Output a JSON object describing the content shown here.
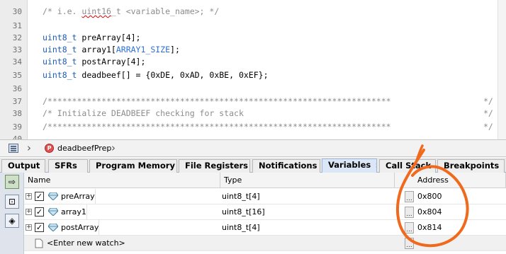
{
  "editor": {
    "lines": [
      {
        "num": "30",
        "text": "/* i.e. uint16_t <variable_name>; */"
      },
      {
        "num": "31",
        "text": ""
      },
      {
        "num": "32",
        "text": "uint8_t preArray[4];"
      },
      {
        "num": "33",
        "text": "uint8_t array1[ARRAY1_SIZE];"
      },
      {
        "num": "34",
        "text": "uint8_t postArray[4];"
      },
      {
        "num": "35",
        "text": "uint8_t deadbeef[] = {0xDE, 0xAD, 0xBE, 0xEF};"
      },
      {
        "num": "36",
        "text": ""
      },
      {
        "num": "37",
        "text": "/***********************************************************************/"
      },
      {
        "num": "38",
        "text": "/* Initialize DEADBEEF checking for stack"
      },
      {
        "num": "39",
        "text": "/***********************************************************************/"
      },
      {
        "num": "40",
        "text": ""
      }
    ],
    "l30_a": "/* i.e. ",
    "l30_b": "uint16",
    "l30_c": "_t <variable_name>; */",
    "l32_type": "uint8_t",
    "l32_rest": " preArray[4];",
    "l33_type": "uint8_t",
    "l33_a": " array1[",
    "l33_const": "ARRAY1_SIZE",
    "l33_b": "];",
    "l34_type": "uint8_t",
    "l34_rest": " postArray[4];",
    "l35_type": "uint8_t",
    "l35_rest": " deadbeef[] = {0xDE, 0xAD, 0xBE, 0xEF};",
    "l37": "/**********************************************************************",
    "l38": "/* Initialize DEADBEEF checking for stack",
    "l39": "/**********************************************************************",
    "edge": "*/"
  },
  "navigator": {
    "function_icon": "P",
    "function_name": "deadbeefPrep"
  },
  "tabs": [
    {
      "label": "Output"
    },
    {
      "label": "SFRs"
    },
    {
      "label": "Program Memory"
    },
    {
      "label": "File Registers"
    },
    {
      "label": "Notifications"
    },
    {
      "label": "Variables",
      "close": "×"
    },
    {
      "label": "Call Stack"
    },
    {
      "label": "Breakpoints"
    }
  ],
  "variables": {
    "columns": {
      "name": "Name",
      "type": "Type",
      "address": "Address"
    },
    "rows": [
      {
        "name": "preArray",
        "type": "uint8_t[4]",
        "address": "0x800",
        "checked": "✓"
      },
      {
        "name": "array1",
        "type": "uint8_t[16]",
        "address": "0x804",
        "checked": "✓"
      },
      {
        "name": "postArray",
        "type": "uint8_t[4]",
        "address": "0x814",
        "checked": "✓"
      }
    ],
    "new_watch": "<Enter new watch>",
    "ellipsis": "..."
  },
  "colors": {
    "accent_tab": "#dbe6f6",
    "annotation": "#f06a1e",
    "keyword": "#1c5fb4",
    "comment": "#8c8c8c"
  }
}
